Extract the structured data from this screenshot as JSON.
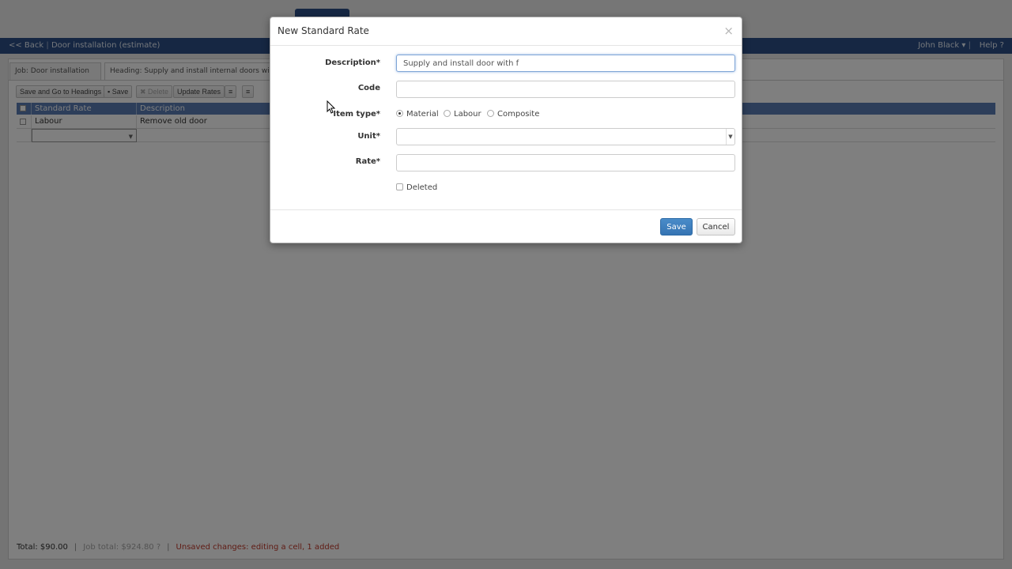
{
  "app": {
    "back_label": "<< Back",
    "job_title": "Door installation (estimate)",
    "user_name": "John Black",
    "help_label": "Help ?"
  },
  "tabs": [
    {
      "label": "Job: Door installation"
    },
    {
      "label": "Heading: Supply and install internal doors with fra"
    }
  ],
  "toolbar": {
    "save_go_label": "Save and Go to Headings",
    "save_label": "Save",
    "delete_label": "Delete",
    "update_rates_label": "Update Rates"
  },
  "grid": {
    "columns": [
      "Standard Rate",
      "Description"
    ],
    "rows": [
      {
        "standard_rate": "Labour",
        "description": "Remove old door"
      }
    ]
  },
  "footer": {
    "total": "Total: $90.00",
    "job_total_label": "Job total:",
    "job_total_value": "$924.80 ?",
    "unsaved": "Unsaved changes: editing a cell, 1 added"
  },
  "modal": {
    "title": "New Standard Rate",
    "close_symbol": "×",
    "description_label": "Description*",
    "description_value": "Supply and install door with f",
    "code_label": "Code",
    "code_value": "",
    "item_type_label": "Item type*",
    "item_types": [
      "Material",
      "Labour",
      "Composite"
    ],
    "item_type_selected": "Material",
    "unit_label": "Unit*",
    "unit_value": "",
    "rate_label": "Rate*",
    "rate_value": "",
    "deleted_label": "Deleted",
    "save_label": "Save",
    "cancel_label": "Cancel"
  },
  "colors": {
    "appbar": "#2c4f87",
    "grid_header": "#5a7db4",
    "primary_button": "#3574b3",
    "warning_text": "#c0392b"
  }
}
